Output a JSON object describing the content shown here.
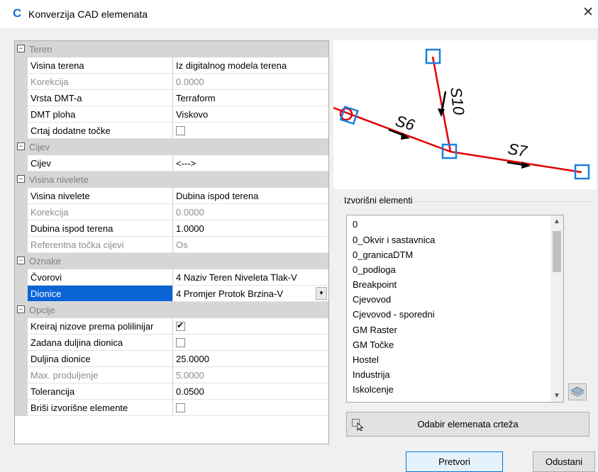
{
  "window": {
    "title": "Konverzija CAD elemenata",
    "close": "✕"
  },
  "grid": {
    "categories": [
      "Teren",
      "Cijev",
      "Visina nivelete",
      "Oznake",
      "Opcije"
    ],
    "rows": [
      {
        "name": "Visina terena",
        "value": "Iz digitalnog modela terena"
      },
      {
        "name": "Korekcija",
        "value": "0.0000"
      },
      {
        "name": "Vrsta DMT-a",
        "value": "Terraform"
      },
      {
        "name": "DMT ploha",
        "value": "Viskovo"
      },
      {
        "name": "Crtaj dodatne točke",
        "checked": false
      },
      {
        "name": "Cijev",
        "value": "<--->"
      },
      {
        "name": "Visina nivelete",
        "value": "Dubina ispod terena"
      },
      {
        "name": "Korekcija",
        "value": "0.0000"
      },
      {
        "name": "Dubina ispod terena",
        "value": "1.0000"
      },
      {
        "name": "Referentna točka cijevi",
        "value": "Os"
      },
      {
        "name": "Čvorovi",
        "value": "4 Naziv Teren Niveleta Tlak-V"
      },
      {
        "name": "Dionice",
        "value": "4 Promjer Protok Brzina-V"
      },
      {
        "name": "Kreiraj nizove prema polilinijar",
        "checked": true
      },
      {
        "name": "Zadana duljina dionica",
        "checked": false
      },
      {
        "name": "Duljina dionice",
        "value": "25.0000"
      },
      {
        "name": "Max. produljenje",
        "value": "5.0000"
      },
      {
        "name": "Tolerancija",
        "value": "0.0500"
      },
      {
        "name": "Briši izvorišne elemente",
        "checked": false
      }
    ]
  },
  "preview": {
    "labels": [
      "S6",
      "S10",
      "S7"
    ]
  },
  "source": {
    "legend": "Izvorišni elementi",
    "items": [
      "0",
      "0_Okvir i sastavnica",
      "0_granicaDTM",
      "0_podloga",
      "Breakpoint",
      "Cjevovod",
      "Cjevovod - sporedni",
      "GM Raster",
      "GM Točke",
      "Hostel",
      "Industrija",
      "Iskolcenje"
    ]
  },
  "buttons": {
    "pick": "Odabir elemenata crteža",
    "convert": "Pretvori",
    "cancel": "Odustani"
  },
  "icons": {
    "app": "app-c-icon",
    "expand": "minus-icon",
    "layers": "layers-icon",
    "pick": "select-cursor-icon"
  },
  "colors": {
    "selection": "#0a64d6",
    "line": "#e00000",
    "node": "#1a7fe0"
  }
}
